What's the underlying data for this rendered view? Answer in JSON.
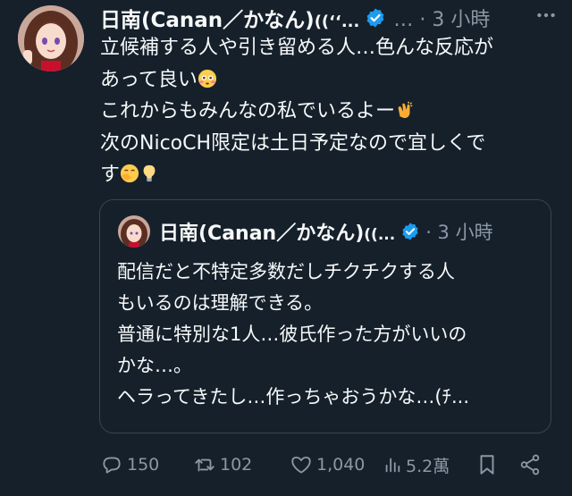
{
  "author": {
    "name": "日南(Canan／かなん)",
    "name_suffix": "((‘‘...",
    "meta": "… · 3 小時"
  },
  "tweet": {
    "lines": [
      "立候補する人や引き留める人…色んな反応が",
      "あって良い",
      "これからもみんなの私でいるよー",
      "次のNicoCH限定は土日予定なので宜しくで",
      "す"
    ],
    "emoji": [
      "flushed-face",
      "clapping-hands",
      "face-with-hand-over-mouth",
      "light-bulb"
    ]
  },
  "quote": {
    "name": "日南(Canan／かなん)",
    "name_suffix": "((...",
    "meta": "· 3 小時",
    "lines": [
      "配信だと不特定多数だしチクチクする人",
      "もいるのは理解できる。",
      "普通に特別な1人…彼氏作った方がいいの",
      "かな…。",
      "ヘラってきたし…作っちゃおうかな…(ﾁ..."
    ]
  },
  "actions": {
    "reply_count": "150",
    "retweet_count": "102",
    "like_count": "1,040",
    "views_count": "5.2萬"
  },
  "colors": {
    "background": "#15202b",
    "text": "#f7f9f9",
    "muted": "#8b98a5",
    "verified": "#1d9bf0",
    "border": "#38444d"
  }
}
